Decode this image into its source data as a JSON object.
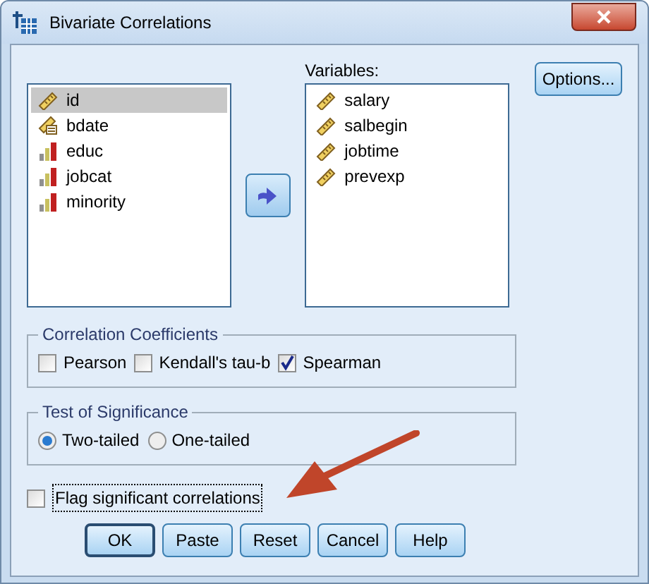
{
  "window": {
    "title": "Bivariate Correlations"
  },
  "source_list": [
    {
      "name": "id",
      "kind": "scale",
      "selected": true
    },
    {
      "name": "bdate",
      "kind": "date",
      "selected": false
    },
    {
      "name": "educ",
      "kind": "ordinal",
      "selected": false
    },
    {
      "name": "jobcat",
      "kind": "ordinal",
      "selected": false
    },
    {
      "name": "minority",
      "kind": "ordinal",
      "selected": false
    }
  ],
  "variables": {
    "label": "Variables:",
    "items": [
      {
        "name": "salary",
        "kind": "scale"
      },
      {
        "name": "salbegin",
        "kind": "scale"
      },
      {
        "name": "jobtime",
        "kind": "scale"
      },
      {
        "name": "prevexp",
        "kind": "scale"
      }
    ]
  },
  "options_button": "Options...",
  "correlation_coefficients": {
    "title": "Correlation Coefficients",
    "options": [
      {
        "label": "Pearson",
        "checked": false
      },
      {
        "label": "Kendall's tau-b",
        "checked": false
      },
      {
        "label": "Spearman",
        "checked": true
      }
    ]
  },
  "test_of_significance": {
    "title": "Test of Significance",
    "options": [
      {
        "label": "Two-tailed",
        "selected": true
      },
      {
        "label": "One-tailed",
        "selected": false
      }
    ]
  },
  "flag": {
    "label": "Flag significant correlations",
    "checked": false
  },
  "buttons": [
    {
      "label": "OK",
      "default": true
    },
    {
      "label": "Paste",
      "default": false
    },
    {
      "label": "Reset",
      "default": false
    },
    {
      "label": "Cancel",
      "default": false
    },
    {
      "label": "Help",
      "default": false
    }
  ]
}
